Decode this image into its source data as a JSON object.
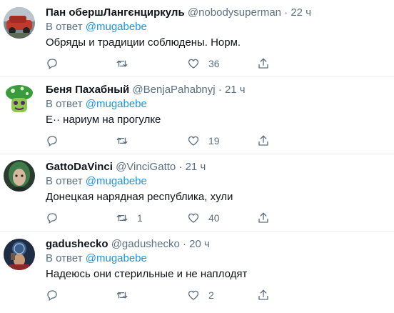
{
  "tweets": [
    {
      "name": "Пан обершЛангєнциркуль",
      "handle": "@nobodysuperman",
      "dot": "·",
      "time": "22 ч",
      "reply_prefix": "В ответ",
      "mention": "@mugabebe",
      "text": "Обряды и традиции соблюдены. Норм.",
      "replies": "",
      "retweets": "",
      "likes": "36"
    },
    {
      "name": "Беня Пахабный",
      "handle": "@BenjaPahabnyj",
      "dot": "·",
      "time": "21 ч",
      "reply_prefix": "В ответ",
      "mention": "@mugabebe",
      "text": "Е·· нариум на прогулке",
      "replies": "",
      "retweets": "",
      "likes": "19"
    },
    {
      "name": "GattoDaVinci",
      "handle": "@VinciGatto",
      "dot": "·",
      "time": "21 ч",
      "reply_prefix": "В ответ",
      "mention": "@mugabebe",
      "text": "Донецкая нарядная республика, хули",
      "replies": "",
      "retweets": "1",
      "likes": "40"
    },
    {
      "name": "gadushecko",
      "handle": "@gadushecko",
      "dot": "·",
      "time": "20 ч",
      "reply_prefix": "В ответ",
      "mention": "@mugabebe",
      "text": "Надеюсь они стерильные и не наплодят",
      "replies": "",
      "retweets": "",
      "likes": "2"
    }
  ],
  "colors": {
    "name": "#0f1419",
    "secondary": "#5b7083",
    "mention": "#1b95e0",
    "divider": "#e6ecf0"
  },
  "icons": {
    "reply": "speech-bubble-icon",
    "retweet": "retweet-arrows-icon",
    "like": "heart-outline-icon",
    "share": "share-upload-icon"
  }
}
